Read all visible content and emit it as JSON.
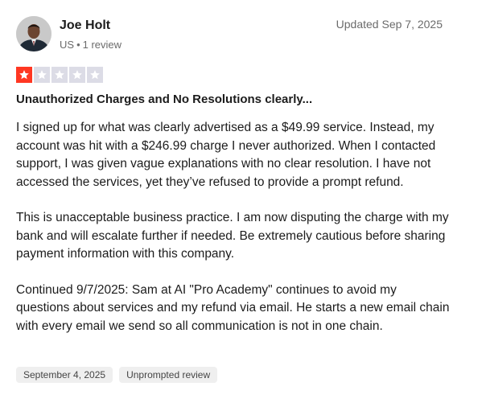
{
  "reviewer": {
    "name": "Joe Holt",
    "country": "US",
    "review_count": "1 review"
  },
  "updated": "Updated Sep 7, 2025",
  "rating": {
    "value": 1,
    "max": 5
  },
  "review": {
    "title": "Unauthorized Charges and No Resolutions clearly...",
    "paragraphs": [
      "I signed up for what was clearly advertised as a $49.99 service. Instead, my account was hit with a $246.99 charge I never authorized. When I contacted support, I was given vague explanations with no clear resolution. I have not accessed the services, yet they’ve refused to provide a prompt refund.",
      "This is unacceptable business practice. I am now disputing the charge with my bank and will escalate further if needed. Be extremely cautious before sharing payment information with this company.",
      "Continued 9/7/2025: Sam at AI \"Pro Academy\" continues to avoid my questions about services and my refund via email. He starts a new email chain with every email we send so all communication is not in one chain."
    ]
  },
  "tags": {
    "date": "September 4, 2025",
    "type": "Unprompted review"
  },
  "colors": {
    "star_filled": "#ff3722",
    "star_empty": "#dcdce6",
    "tag_bg": "#efefef"
  }
}
